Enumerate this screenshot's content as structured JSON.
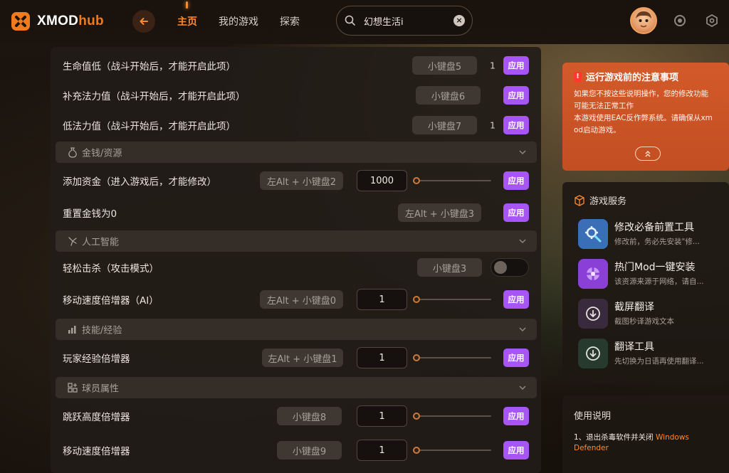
{
  "app": {
    "logo_x": "XMOD",
    "logo_hub": "hub"
  },
  "nav": {
    "items": [
      "主页",
      "我的游戏",
      "探索"
    ]
  },
  "search": {
    "value": "幻想生活i"
  },
  "rows": {
    "r1": {
      "label": "生命值低（战斗开始后，才能开启此项）",
      "key": "小键盘5",
      "value": "1",
      "apply": "应用"
    },
    "r2": {
      "label": "补充法力值（战斗开始后，才能开启此项）",
      "key": "小键盘6",
      "apply": "应用"
    },
    "r3": {
      "label": "低法力值（战斗开始后，才能开启此项）",
      "key": "小键盘7",
      "value": "1",
      "apply": "应用"
    },
    "s1": {
      "label": "金钱/资源"
    },
    "r4": {
      "label": "添加资金（进入游戏后，才能修改）",
      "key": "左Alt + 小键盘2",
      "input": "1000",
      "slider": 0,
      "apply": "应用"
    },
    "r5": {
      "label": "重置金钱为0",
      "key": "左Alt + 小键盘3",
      "apply": "应用"
    },
    "s2": {
      "label": "人工智能"
    },
    "r6": {
      "label": "轻松击杀（攻击模式）",
      "key": "小键盘3",
      "toggle": false
    },
    "r7": {
      "label": "移动速度倍增器（AI）",
      "key": "左Alt + 小键盘0",
      "input": "1",
      "slider": 0,
      "apply": "应用"
    },
    "s3": {
      "label": "技能/经验"
    },
    "r8": {
      "label": "玩家经验倍增器",
      "key": "左Alt + 小键盘1",
      "input": "1",
      "slider": 0,
      "apply": "应用"
    },
    "s4": {
      "label": "球员属性"
    },
    "r9": {
      "label": "跳跃高度倍增器",
      "key": "小键盘8",
      "input": "1",
      "slider": 0,
      "apply": "应用"
    },
    "r10": {
      "label": "移动速度倍增器",
      "key": "小键盘9",
      "input": "1",
      "slider": 0,
      "apply": "应用"
    }
  },
  "notice": {
    "title": "运行游戏前的注意事项",
    "line1": "如果您不按这些说明操作，您的修改功能",
    "line2": "可能无法正常工作",
    "line3": "本游戏使用EAC反作弊系统。请确保从xm",
    "line4": "od启动游戏。"
  },
  "services": {
    "title": "游戏服务",
    "items": [
      {
        "name": "修改必备前置工具",
        "desc": "修改前，务必先安装\"修..."
      },
      {
        "name": "热门Mod一键安装",
        "desc": "该资源来源于网络，请自..."
      },
      {
        "name": "截屏翻译",
        "desc": "截图秒译游戏文本"
      },
      {
        "name": "翻译工具",
        "desc": "先切换为日语再使用翻译..."
      }
    ]
  },
  "guide": {
    "title": "使用说明",
    "step1": "1、退出杀毒软件并关闭",
    "step1_hl": "Windows Defender"
  },
  "colors": {
    "accent": "#ff8a2a",
    "apply": "#a855f7",
    "notice_bg": "#d35a2a"
  }
}
